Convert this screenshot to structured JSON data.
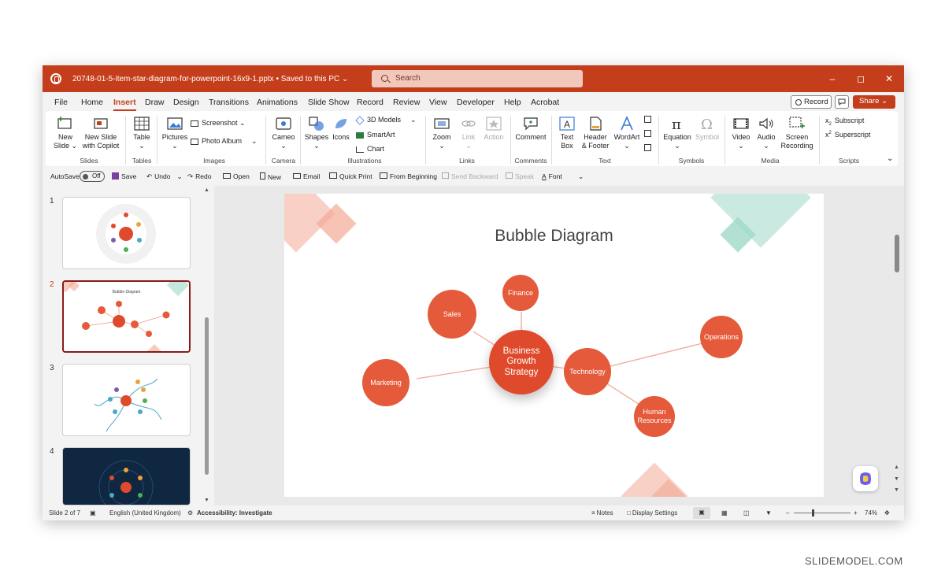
{
  "window": {
    "file_name": "20748-01-5-item-star-diagram-for-powerpoint-16x9-1.pptx • Saved to this PC ⌄",
    "search_placeholder": "Search"
  },
  "menu": {
    "tabs": [
      "File",
      "Home",
      "Insert",
      "Draw",
      "Design",
      "Transitions",
      "Animations",
      "Slide Show",
      "Record",
      "Review",
      "View",
      "Developer",
      "Help",
      "Acrobat"
    ],
    "active_tab": "Insert",
    "record_label": "Record",
    "share_label": "Share ⌄"
  },
  "ribbon": {
    "slides": {
      "new_slide": "New\nSlide ⌄",
      "new_slide_copilot": "New Slide\nwith Copilot",
      "group": "Slides"
    },
    "tables": {
      "table": "Table\n⌄",
      "group": "Tables"
    },
    "images": {
      "pictures": "Pictures\n⌄",
      "screenshot": "Screenshot ⌄",
      "photo_album": "Photo Album",
      "group": "Images"
    },
    "camera": {
      "cameo": "Cameo\n⌄",
      "group": "Camera"
    },
    "illustrations": {
      "shapes": "Shapes\n⌄",
      "icons": "Icons",
      "models_3d": "3D Models",
      "smartart": "SmartArt",
      "chart": "Chart",
      "group": "Illustrations"
    },
    "links": {
      "zoom": "Zoom\n⌄",
      "link": "Link\n⌄",
      "action": "Action",
      "group": "Links"
    },
    "comments": {
      "comment": "Comment",
      "group": "Comments"
    },
    "text": {
      "text_box": "Text\nBox",
      "header_footer": "Header\n& Footer",
      "wordart": "WordArt\n⌄",
      "group": "Text"
    },
    "symbols": {
      "equation": "Equation\n⌄",
      "symbol": "Symbol",
      "group": "Symbols"
    },
    "media": {
      "video": "Video\n⌄",
      "audio": "Audio\n⌄",
      "screen_recording": "Screen\nRecording",
      "group": "Media"
    },
    "scripts": {
      "subscript": "Subscript",
      "superscript": "Superscript",
      "group": "Scripts"
    }
  },
  "qat": {
    "autosave": "AutoSave",
    "autosave_state": "Off",
    "save": "Save",
    "undo": "Undo",
    "redo": "Redo",
    "open": "Open",
    "new": "New",
    "email": "Email",
    "quick_print": "Quick Print",
    "from_beginning": "From Beginning",
    "send_backward": "Send Backward",
    "speak": "Speak",
    "font": "Font"
  },
  "thumbnails": [
    {
      "number": "1",
      "selected": false
    },
    {
      "number": "2",
      "selected": true
    },
    {
      "number": "3",
      "selected": false
    },
    {
      "number": "4",
      "selected": false
    }
  ],
  "slide": {
    "title": "Bubble Diagram",
    "center": "Business\nGrowth\nStrategy",
    "bubbles": [
      "Sales",
      "Finance",
      "Operations",
      "Technology",
      "Human\nResources",
      "Marketing"
    ],
    "thumb_title": "Bubble Diagram"
  },
  "status": {
    "slide_position": "Slide 2 of 7",
    "language": "English (United Kingdom)",
    "accessibility": "Accessibility: Investigate",
    "notes": "Notes",
    "display_settings": "Display Settings",
    "zoom": "74%"
  },
  "watermark": "SLIDEMODEL.COM",
  "colors": {
    "accent": "#c43e1c",
    "bubble": "#e45a3a",
    "teal": "#9fd9c8",
    "salmon": "#f2a995"
  }
}
